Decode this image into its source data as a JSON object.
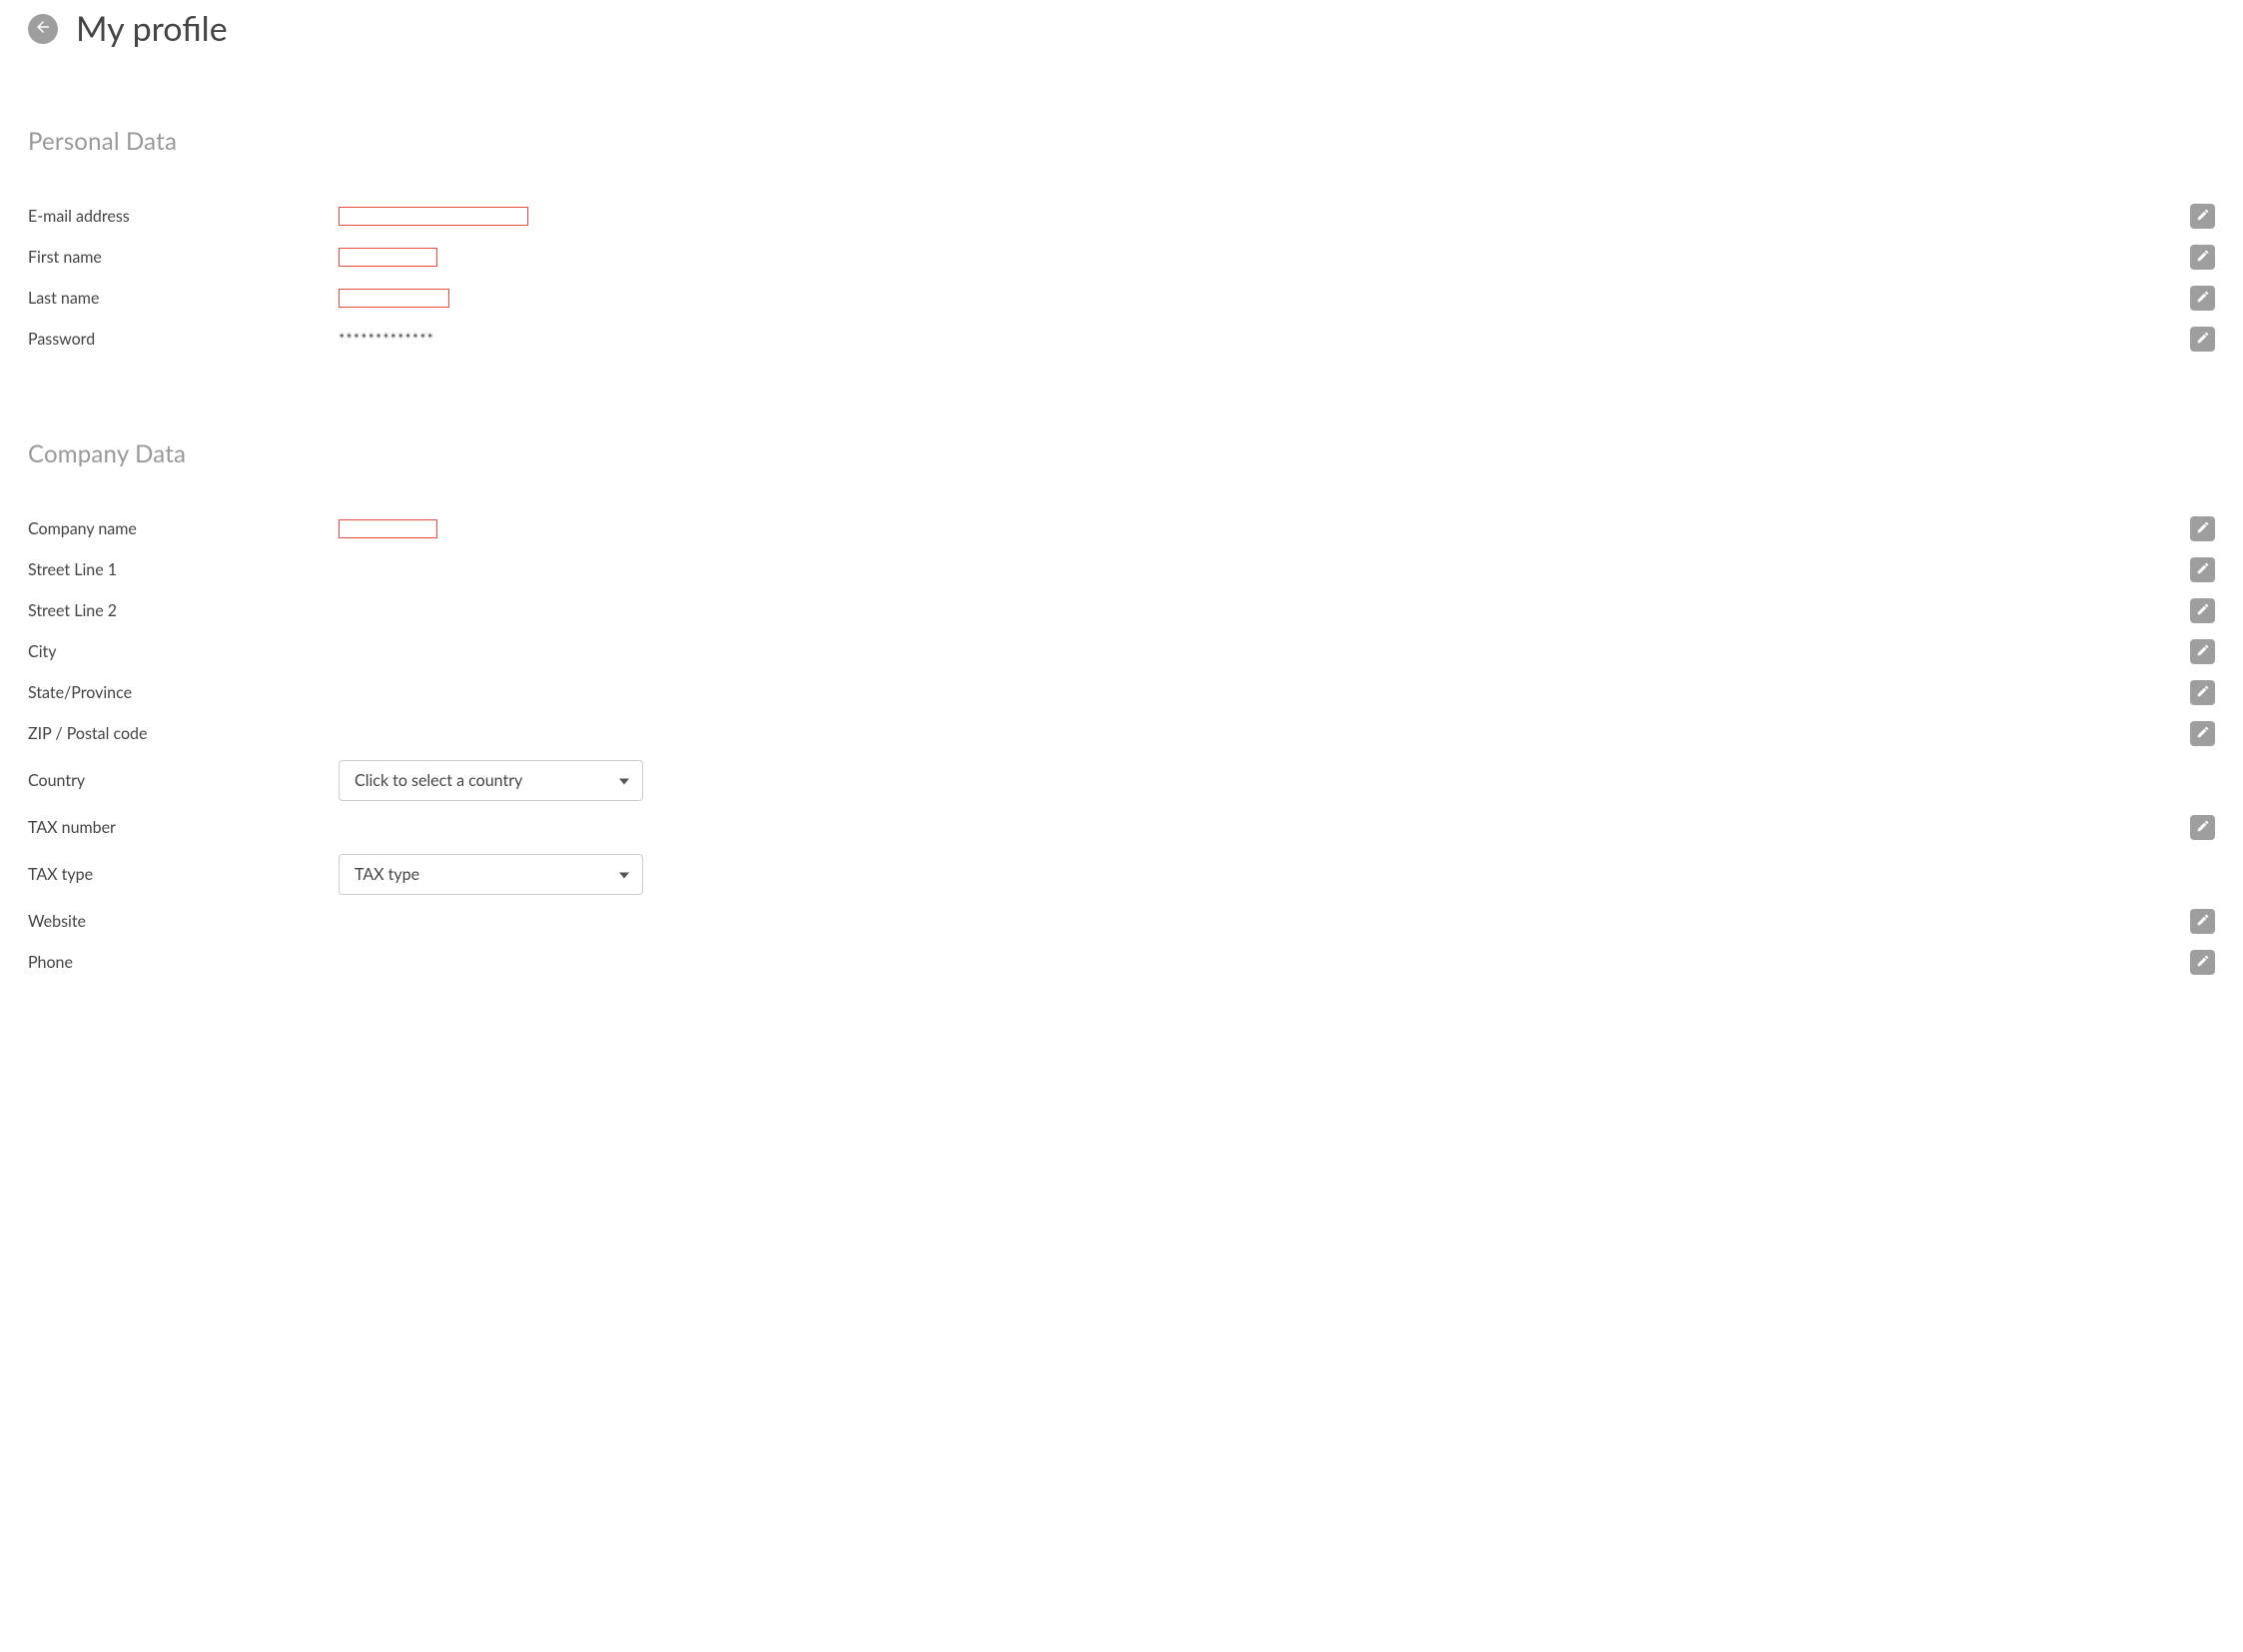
{
  "page": {
    "title": "My profile"
  },
  "personal": {
    "section_title": "Personal Data",
    "email_label": "E-mail address",
    "first_name_label": "First name",
    "last_name_label": "Last name",
    "password_label": "Password",
    "password_mask": "*************"
  },
  "company": {
    "section_title": "Company Data",
    "company_name_label": "Company name",
    "street1_label": "Street Line 1",
    "street2_label": "Street Line 2",
    "city_label": "City",
    "state_label": "State/Province",
    "zip_label": "ZIP / Postal code",
    "country_label": "Country",
    "country_placeholder": "Click to select a country",
    "tax_number_label": "TAX number",
    "tax_type_label": "TAX type",
    "tax_type_placeholder": "TAX type",
    "website_label": "Website",
    "phone_label": "Phone"
  }
}
